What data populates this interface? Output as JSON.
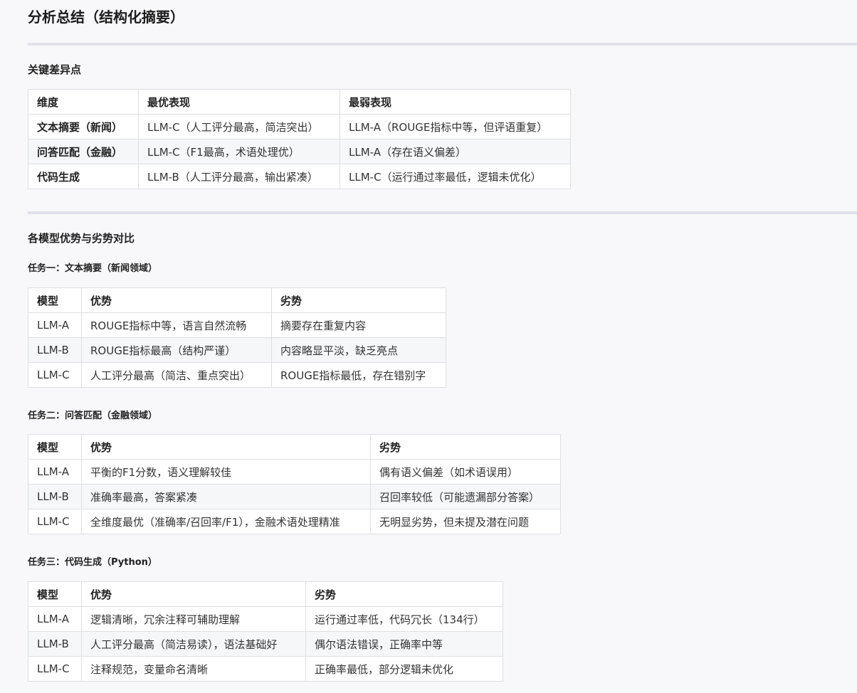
{
  "title": "分析总结（结构化摘要）",
  "key_diff": {
    "heading": "关键差异点",
    "headers": [
      "维度",
      "最优表现",
      "最弱表现"
    ],
    "rows": [
      [
        "文本摘要（新闻）",
        "LLM-C（人工评分最高，简洁突出）",
        "LLM-A（ROUGE指标中等，但评语重复）"
      ],
      [
        "问答匹配（金融）",
        "LLM-C（F1最高，术语处理优）",
        "LLM-A（存在语义偏差）"
      ],
      [
        "代码生成",
        "LLM-B（人工评分最高，输出紧凑）",
        "LLM-C（运行通过率最低，逻辑未优化）"
      ]
    ]
  },
  "compare": {
    "heading": "各模型优势与劣势对比",
    "tasks": [
      {
        "title": "任务一：文本摘要（新闻领域）",
        "headers": [
          "模型",
          "优势",
          "劣势"
        ],
        "rows": [
          [
            "LLM-A",
            "ROUGE指标中等，语言自然流畅",
            "摘要存在重复内容"
          ],
          [
            "LLM-B",
            "ROUGE指标最高（结构严谨）",
            "内容略显平淡，缺乏亮点"
          ],
          [
            "LLM-C",
            "人工评分最高（简洁、重点突出）",
            "ROUGE指标最低，存在错别字"
          ]
        ]
      },
      {
        "title": "任务二：问答匹配（金融领域）",
        "headers": [
          "模型",
          "优势",
          "劣势"
        ],
        "rows": [
          [
            "LLM-A",
            "平衡的F1分数，语义理解较佳",
            "偶有语义偏差（如术语误用）"
          ],
          [
            "LLM-B",
            "准确率最高，答案紧凑",
            "召回率较低（可能遗漏部分答案）"
          ],
          [
            "LLM-C",
            "全维度最优（准确率/召回率/F1），金融术语处理精准",
            "无明显劣势，但未提及潜在问题"
          ]
        ]
      },
      {
        "title": "任务三：代码生成（Python）",
        "headers": [
          "模型",
          "优势",
          "劣势"
        ],
        "rows": [
          [
            "LLM-A",
            "逻辑清晰，冗余注释可辅助理解",
            "运行通过率低，代码冗长（134行）"
          ],
          [
            "LLM-B",
            "人工评分最高（简洁易读），语法基础好",
            "偶尔语法错误，正确率中等"
          ],
          [
            "LLM-C",
            "注释规范，变量命名清晰",
            "正确率最低，部分逻辑未优化"
          ]
        ]
      }
    ]
  }
}
